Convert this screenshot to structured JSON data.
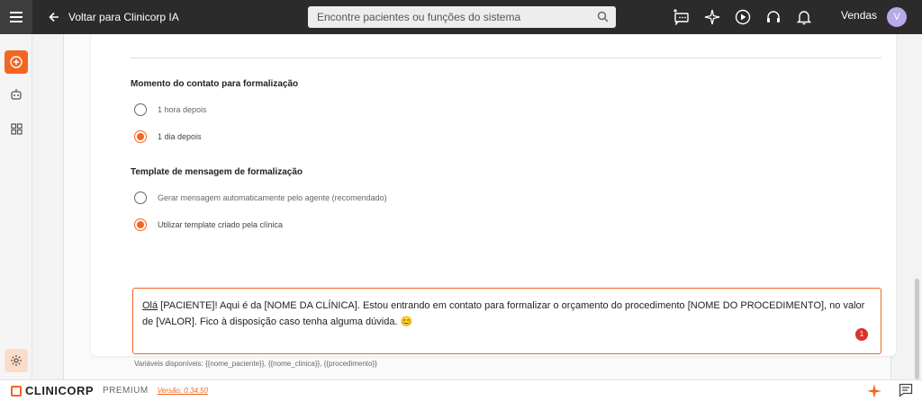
{
  "header": {
    "back_label": "Voltar para Clinicorp IA",
    "search_placeholder": "Encontre pacientes ou funções do sistema",
    "user_name": "Vendas",
    "avatar_initial": "V"
  },
  "sidebar": {
    "items": [
      {
        "icon": "add-circle-icon",
        "active": true
      },
      {
        "icon": "robot-icon",
        "active": false
      },
      {
        "icon": "grid-icon",
        "active": false
      },
      {
        "icon": "gear-icon",
        "active": false
      }
    ]
  },
  "sections": {
    "moment_title": "Momento do contato para formalização",
    "moment_options": [
      {
        "label": "1 hora depois",
        "selected": false
      },
      {
        "label": "1 dia depois",
        "selected": true
      }
    ],
    "template_title": "Template de mensagem de formalização",
    "template_options": [
      {
        "label": "Gerar mensagem automaticamente pelo agente (recomendado)",
        "selected": false
      },
      {
        "label": "Utilizar template criado pela clínica",
        "selected": true
      }
    ]
  },
  "template_text": {
    "first_word": "Olá",
    "rest": " [PACIENTE]! Aqui é da [NOME DA CLÍNICA]. Estou entrando em contato para formalizar o orçamento do procedimento [NOME DO PROCEDIMENTO], no valor de [VALOR]. Fico à disposição caso tenha alguma dúvida. 😊",
    "error_count": "1"
  },
  "variables_hint": "Variáveis disponíveis: {{nome_paciente}}, {{nome_clinica}}, {{procedimento}}",
  "footer": {
    "brand": "CLINICORP",
    "plan": "PREMIUM",
    "version": "Versão: 0.34.50"
  },
  "colors": {
    "accent": "#f26522",
    "topbar": "#2b2b2b",
    "error": "#d9342b"
  }
}
